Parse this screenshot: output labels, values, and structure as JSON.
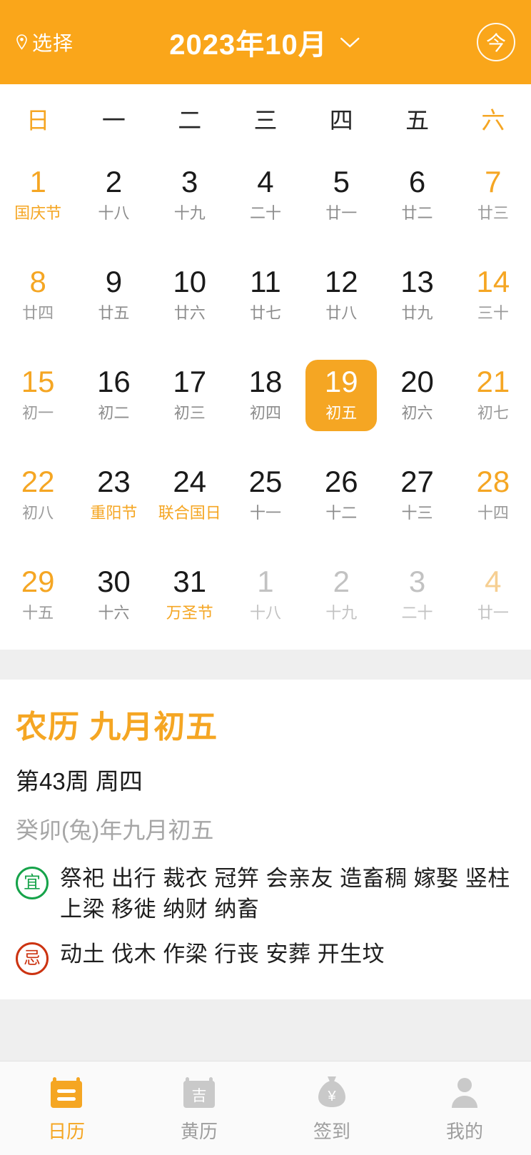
{
  "header": {
    "location_label": "选择",
    "location_icon": "location-pin-icon",
    "title": "2023年10月",
    "dropdown_icon": "chevron-down-icon",
    "today_label": "今",
    "accent_color": "#FAA61A"
  },
  "calendar": {
    "weekdays": [
      {
        "label": "日",
        "weekend": true
      },
      {
        "label": "一",
        "weekend": false
      },
      {
        "label": "二",
        "weekend": false
      },
      {
        "label": "三",
        "weekend": false
      },
      {
        "label": "四",
        "weekend": false
      },
      {
        "label": "五",
        "weekend": false
      },
      {
        "label": "六",
        "weekend": true
      }
    ],
    "weeks": [
      [
        {
          "day": "1",
          "sub": "国庆节",
          "weekend": true,
          "holiday": true,
          "out": false,
          "selected": false
        },
        {
          "day": "2",
          "sub": "十八",
          "weekend": false,
          "holiday": false,
          "out": false,
          "selected": false
        },
        {
          "day": "3",
          "sub": "十九",
          "weekend": false,
          "holiday": false,
          "out": false,
          "selected": false
        },
        {
          "day": "4",
          "sub": "二十",
          "weekend": false,
          "holiday": false,
          "out": false,
          "selected": false
        },
        {
          "day": "5",
          "sub": "廿一",
          "weekend": false,
          "holiday": false,
          "out": false,
          "selected": false
        },
        {
          "day": "6",
          "sub": "廿二",
          "weekend": false,
          "holiday": false,
          "out": false,
          "selected": false
        },
        {
          "day": "7",
          "sub": "廿三",
          "weekend": true,
          "holiday": false,
          "out": false,
          "selected": false
        }
      ],
      [
        {
          "day": "8",
          "sub": "廿四",
          "weekend": true,
          "holiday": false,
          "out": false,
          "selected": false
        },
        {
          "day": "9",
          "sub": "廿五",
          "weekend": false,
          "holiday": false,
          "out": false,
          "selected": false
        },
        {
          "day": "10",
          "sub": "廿六",
          "weekend": false,
          "holiday": false,
          "out": false,
          "selected": false
        },
        {
          "day": "11",
          "sub": "廿七",
          "weekend": false,
          "holiday": false,
          "out": false,
          "selected": false
        },
        {
          "day": "12",
          "sub": "廿八",
          "weekend": false,
          "holiday": false,
          "out": false,
          "selected": false
        },
        {
          "day": "13",
          "sub": "廿九",
          "weekend": false,
          "holiday": false,
          "out": false,
          "selected": false
        },
        {
          "day": "14",
          "sub": "三十",
          "weekend": true,
          "holiday": false,
          "out": false,
          "selected": false
        }
      ],
      [
        {
          "day": "15",
          "sub": "初一",
          "weekend": true,
          "holiday": false,
          "out": false,
          "selected": false
        },
        {
          "day": "16",
          "sub": "初二",
          "weekend": false,
          "holiday": false,
          "out": false,
          "selected": false
        },
        {
          "day": "17",
          "sub": "初三",
          "weekend": false,
          "holiday": false,
          "out": false,
          "selected": false
        },
        {
          "day": "18",
          "sub": "初四",
          "weekend": false,
          "holiday": false,
          "out": false,
          "selected": false
        },
        {
          "day": "19",
          "sub": "初五",
          "weekend": false,
          "holiday": false,
          "out": false,
          "selected": true
        },
        {
          "day": "20",
          "sub": "初六",
          "weekend": false,
          "holiday": false,
          "out": false,
          "selected": false
        },
        {
          "day": "21",
          "sub": "初七",
          "weekend": true,
          "holiday": false,
          "out": false,
          "selected": false
        }
      ],
      [
        {
          "day": "22",
          "sub": "初八",
          "weekend": true,
          "holiday": false,
          "out": false,
          "selected": false
        },
        {
          "day": "23",
          "sub": "重阳节",
          "weekend": false,
          "holiday": true,
          "out": false,
          "selected": false
        },
        {
          "day": "24",
          "sub": "联合国日",
          "weekend": false,
          "holiday": true,
          "out": false,
          "selected": false
        },
        {
          "day": "25",
          "sub": "十一",
          "weekend": false,
          "holiday": false,
          "out": false,
          "selected": false
        },
        {
          "day": "26",
          "sub": "十二",
          "weekend": false,
          "holiday": false,
          "out": false,
          "selected": false
        },
        {
          "day": "27",
          "sub": "十三",
          "weekend": false,
          "holiday": false,
          "out": false,
          "selected": false
        },
        {
          "day": "28",
          "sub": "十四",
          "weekend": true,
          "holiday": false,
          "out": false,
          "selected": false
        }
      ],
      [
        {
          "day": "29",
          "sub": "十五",
          "weekend": true,
          "holiday": false,
          "out": false,
          "selected": false
        },
        {
          "day": "30",
          "sub": "十六",
          "weekend": false,
          "holiday": false,
          "out": false,
          "selected": false
        },
        {
          "day": "31",
          "sub": "万圣节",
          "weekend": false,
          "holiday": true,
          "out": false,
          "selected": false
        },
        {
          "day": "1",
          "sub": "十八",
          "weekend": false,
          "holiday": false,
          "out": true,
          "selected": false
        },
        {
          "day": "2",
          "sub": "十九",
          "weekend": false,
          "holiday": false,
          "out": true,
          "selected": false
        },
        {
          "day": "3",
          "sub": "二十",
          "weekend": false,
          "holiday": false,
          "out": true,
          "selected": false
        },
        {
          "day": "4",
          "sub": "廿一",
          "weekend": true,
          "holiday": false,
          "out": true,
          "selected": false
        }
      ]
    ]
  },
  "detail": {
    "lunar_title": "农历 九月初五",
    "week_line": "第43周 周四",
    "ganzhi": "癸卯(兔)年九月初五",
    "yi": {
      "badge": "宜",
      "badge_color": "#16A34A",
      "text": "祭祀 出行 裁衣 冠笄 会亲友 造畜稠 嫁娶 竖柱 上梁 移徙 纳财 纳畜"
    },
    "ji": {
      "badge": "忌",
      "badge_color": "#CC3311",
      "text": "动土 伐木 作梁 行丧 安葬 开生坟"
    }
  },
  "tabbar": {
    "items": [
      {
        "label": "日历",
        "icon": "calendar-icon",
        "active": true
      },
      {
        "label": "黄历",
        "icon": "almanac-icon",
        "active": false
      },
      {
        "label": "签到",
        "icon": "money-bag-icon",
        "active": false
      },
      {
        "label": "我的",
        "icon": "person-icon",
        "active": false
      }
    ]
  }
}
